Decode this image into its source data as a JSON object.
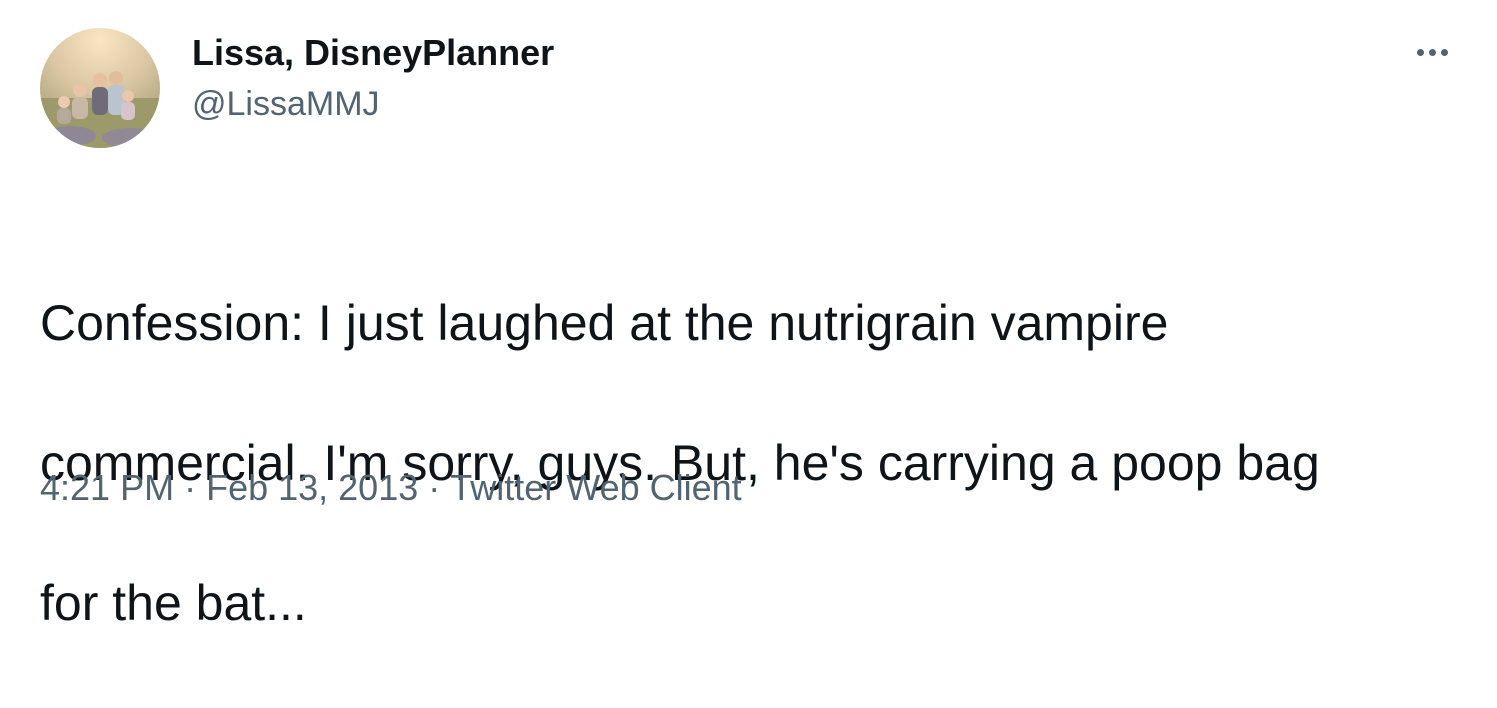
{
  "author": {
    "display_name": "Lissa, DisneyPlanner",
    "handle": "@LissaMMJ",
    "avatar_icon": "family-photo-avatar"
  },
  "tweet": {
    "text_lines": [
      "Confession: I just laughed at the nutrigrain vampire",
      "commercial. I'm sorry, guys. But, he's carrying a poop bag",
      "for the bat..."
    ]
  },
  "meta": {
    "time": "4:21 PM",
    "separator": "·",
    "date": "Feb 13, 2013",
    "client": "Twitter Web Client"
  },
  "actions": {
    "more_icon": "more-options-icon"
  },
  "colors": {
    "text_primary": "#0f1419",
    "text_secondary": "#536471",
    "background": "#ffffff"
  }
}
